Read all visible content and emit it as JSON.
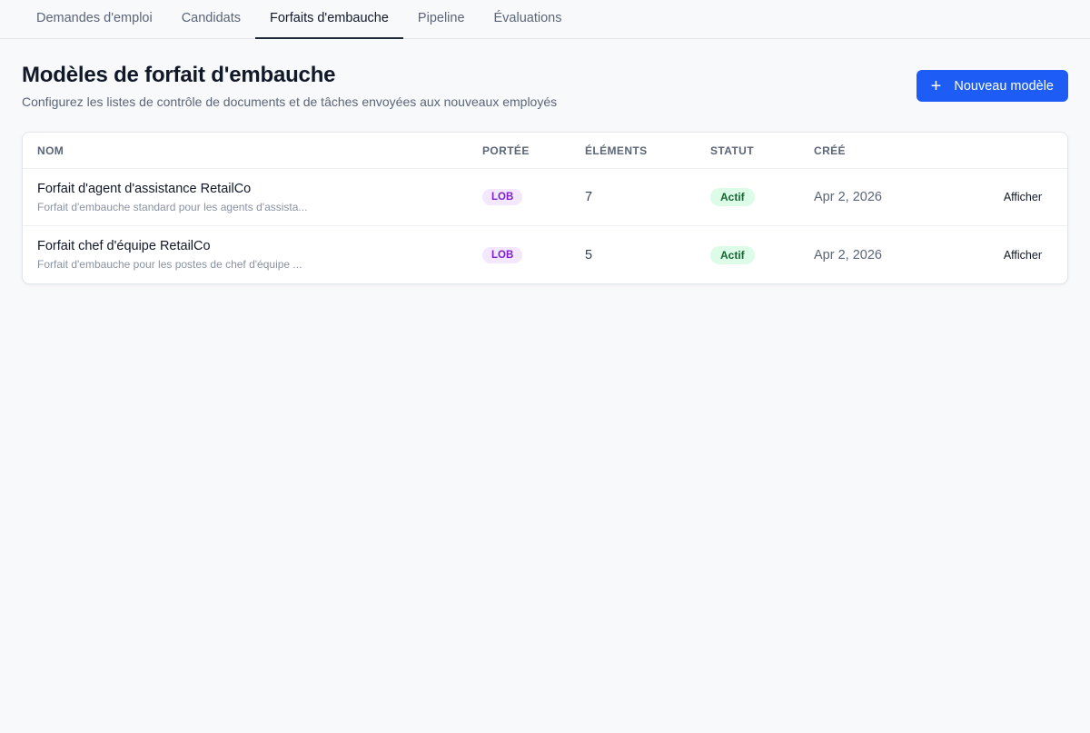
{
  "tabs": [
    {
      "label": "Demandes d'emploi"
    },
    {
      "label": "Candidats"
    },
    {
      "label": "Forfaits d'embauche"
    },
    {
      "label": "Pipeline"
    },
    {
      "label": "Évaluations"
    }
  ],
  "active_tab": "Forfaits d'embauche",
  "page": {
    "title": "Modèles de forfait d'embauche",
    "subtitle": "Configurez les listes de contrôle de documents et de tâches envoyées aux nouveaux employés",
    "new_button_label": "Nouveau modèle",
    "new_button_icon": "plus-icon"
  },
  "table": {
    "columns": {
      "name": "NOM",
      "scope": "PORTÉE",
      "items": "ÉLÉMENTS",
      "status": "STATUT",
      "created": "CRÉÉ"
    },
    "rows": [
      {
        "name": "Forfait d'agent d'assistance RetailCo",
        "description": "Forfait d'embauche standard pour les agents d'assista...",
        "scope": "LOB",
        "items": "7",
        "status": "Actif",
        "created": "Apr 2, 2026",
        "action": "Afficher"
      },
      {
        "name": "Forfait chef d'équipe RetailCo",
        "description": "Forfait d'embauche pour les postes de chef d'équipe ...",
        "scope": "LOB",
        "items": "5",
        "status": "Actif",
        "created": "Apr 2, 2026",
        "action": "Afficher"
      }
    ]
  },
  "colors": {
    "accent": "#1d5cf5",
    "scope_badge_bg": "#f3e8ff",
    "scope_badge_text": "#7e22ce",
    "status_badge_bg": "#dcfce7",
    "status_badge_text": "#166534"
  }
}
